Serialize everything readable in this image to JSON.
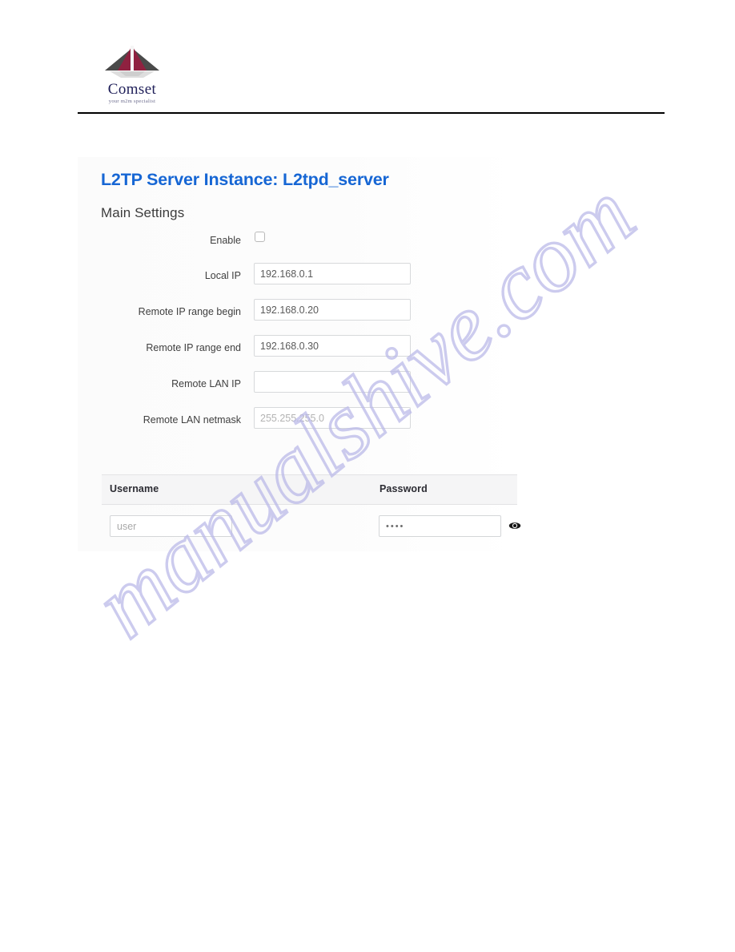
{
  "header": {
    "logo": {
      "brand": "Comset",
      "tagline": "your m2m specialist",
      "mark_colors": {
        "maroon": "#8f2140",
        "dark_gray": "#4a4a4a",
        "reflection": "#cfcfcf"
      }
    }
  },
  "screenshot": {
    "title": "L2TP Server Instance: L2tpd_server",
    "title_color": "#1666d4",
    "section_heading": "Main Settings",
    "fields": [
      {
        "label": "Enable",
        "type": "checkbox",
        "checked": false,
        "value": ""
      },
      {
        "label": "Local IP",
        "type": "text",
        "value": "192.168.0.1",
        "placeholder": "",
        "muted": false
      },
      {
        "label": "Remote IP range begin",
        "type": "text",
        "value": "192.168.0.20",
        "placeholder": "",
        "muted": false
      },
      {
        "label": "Remote IP range end",
        "type": "text",
        "value": "192.168.0.30",
        "placeholder": "",
        "muted": false
      },
      {
        "label": "Remote LAN IP",
        "type": "text",
        "value": "",
        "placeholder": "",
        "muted": false
      },
      {
        "label": "Remote LAN netmask",
        "type": "text",
        "value": "255.255.255.0",
        "placeholder": "255.255.255.0",
        "muted": true
      }
    ],
    "credentials": {
      "columns": [
        "Username",
        "Password"
      ],
      "rows": [
        {
          "username": "user",
          "username_placeholder": "user",
          "password": "••••",
          "password_masked_length": 4,
          "reveal_icon": "eye-icon"
        }
      ]
    }
  },
  "watermark": {
    "text": "manualshive.com",
    "color": "#b9b8e8"
  }
}
